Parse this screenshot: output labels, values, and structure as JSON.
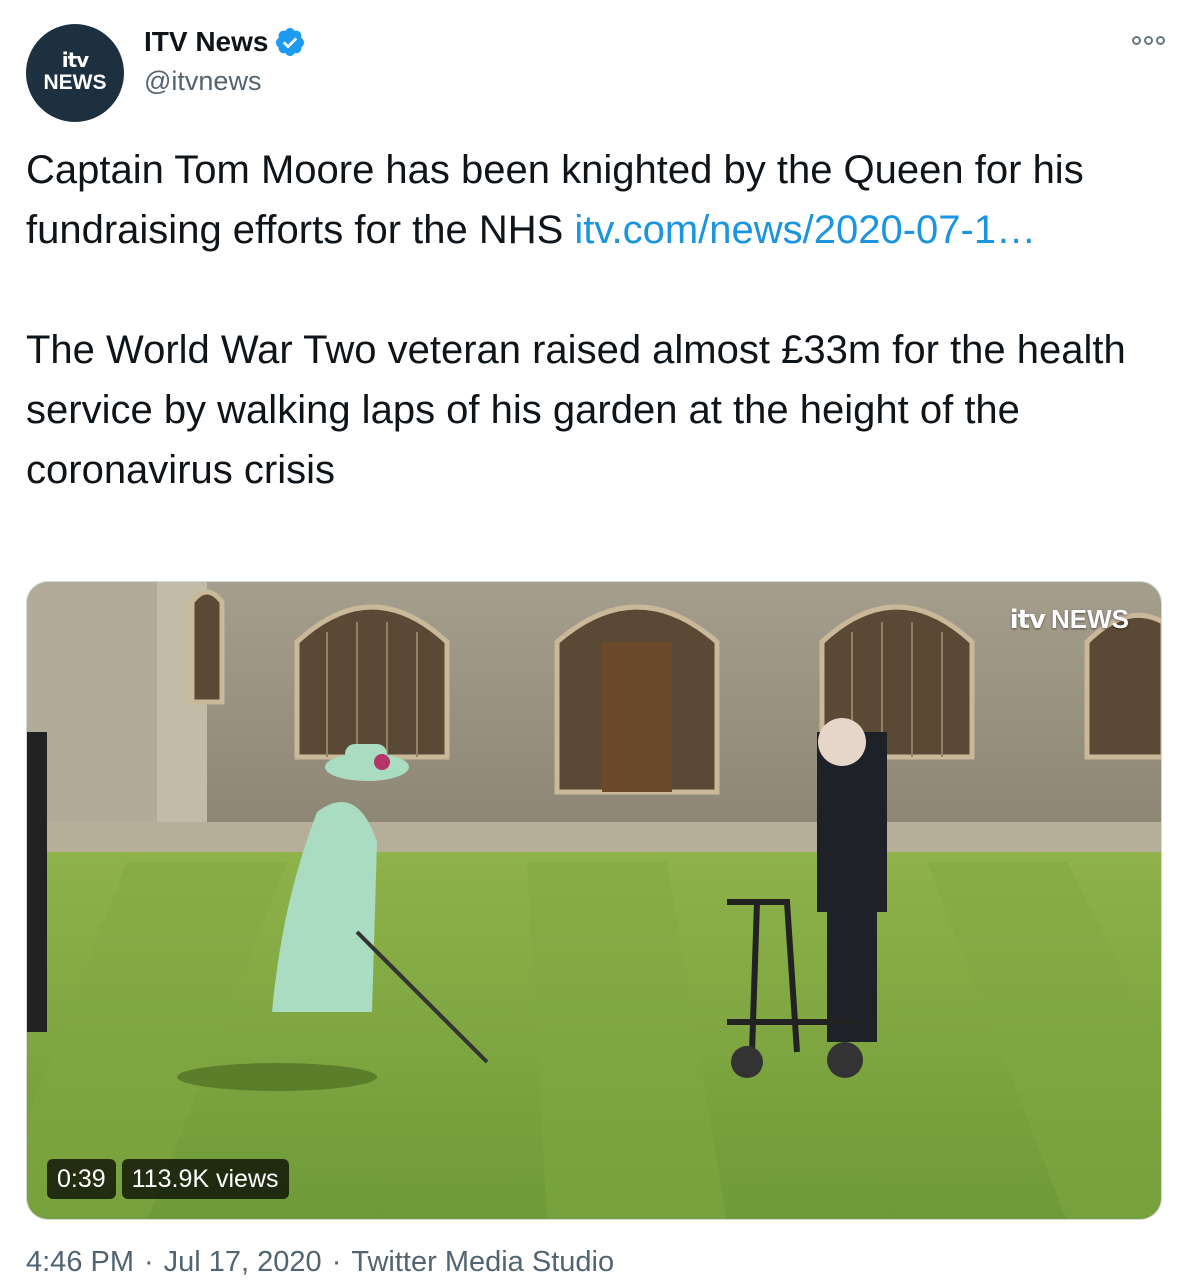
{
  "account": {
    "avatar_logo": "itv",
    "avatar_label": "NEWS",
    "display_name": "ITV News",
    "handle": "@itvnews",
    "verified_icon": "verified-badge-icon",
    "more_icon": "more-options-icon"
  },
  "tweet": {
    "text_part1": "Captain Tom Moore has been knighted by the Queen for his fundraising efforts for the NHS ",
    "link_text": "itv.com/news/2020-07-1…",
    "text_part2": "\n\nThe World War Two veteran raised almost £33m for the health service by walking laps of his garden at the height of the coronavirus crisis"
  },
  "media": {
    "watermark_logo": "itv",
    "watermark_label": "NEWS",
    "duration": "0:39",
    "views": "113.9K views"
  },
  "footer": {
    "time": "4:46 PM",
    "separator": "·",
    "date": "Jul 17, 2020",
    "source": "Twitter Media Studio"
  },
  "colors": {
    "link": "#1b95e0",
    "secondary_text": "#536471",
    "verified": "#1d9bf0",
    "avatar_bg": "#1c3040"
  }
}
